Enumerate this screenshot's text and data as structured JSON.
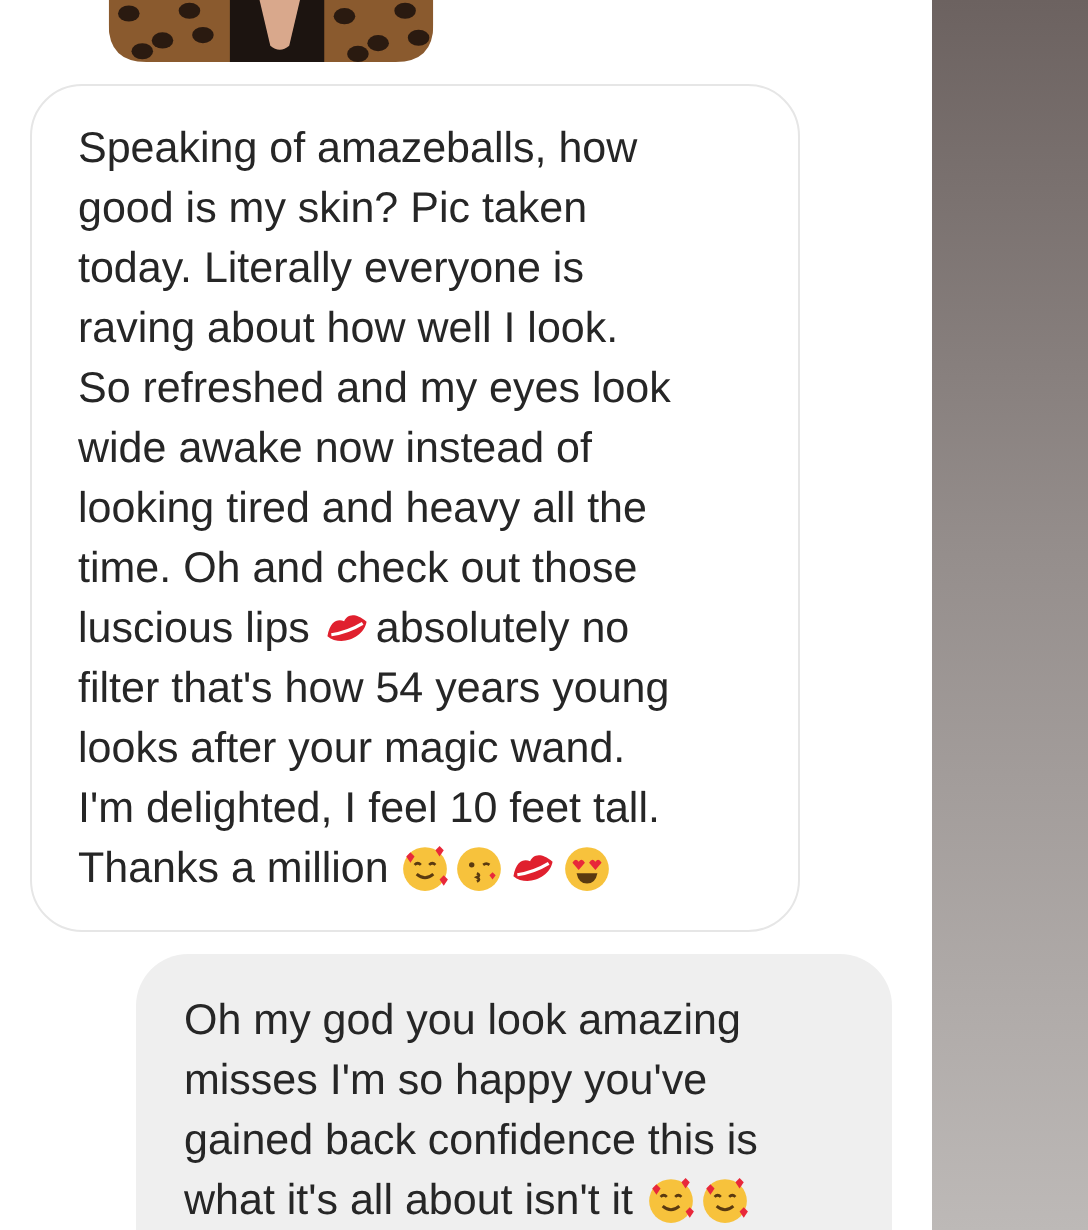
{
  "messages": [
    {
      "kind": "received",
      "lines": [
        [
          {
            "kind": "text",
            "text": "Speaking of amazeballs, how"
          }
        ],
        [
          {
            "kind": "text",
            "text": "good is my skin? Pic taken"
          }
        ],
        [
          {
            "kind": "text",
            "text": "today. Literally everyone is"
          }
        ],
        [
          {
            "kind": "text",
            "text": "raving about how well I look."
          }
        ],
        [
          {
            "kind": "text",
            "text": "So refreshed and my eyes look"
          }
        ],
        [
          {
            "kind": "text",
            "text": "wide awake now instead of"
          }
        ],
        [
          {
            "kind": "text",
            "text": "looking tired and heavy all the"
          }
        ],
        [
          {
            "kind": "text",
            "text": "time. Oh and check out those"
          }
        ],
        [
          {
            "kind": "text",
            "text": "luscious lips"
          },
          {
            "kind": "lips"
          },
          {
            "kind": "text",
            "text": "absolutely no"
          }
        ],
        [
          {
            "kind": "text",
            "text": "filter that's how 54 years young"
          }
        ],
        [
          {
            "kind": "text",
            "text": "looks after your magic wand."
          }
        ],
        [
          {
            "kind": "text",
            "text": "I'm delighted, I feel 10 feet tall."
          }
        ],
        [
          {
            "kind": "text",
            "text": "Thanks a million"
          },
          {
            "kind": "hearts_face"
          },
          {
            "kind": "kiss_face"
          },
          {
            "kind": "lips"
          },
          {
            "kind": "heart_eyes"
          }
        ]
      ]
    },
    {
      "kind": "sent",
      "lines": [
        [
          {
            "kind": "text",
            "text": "Oh my god you look amazing"
          }
        ],
        [
          {
            "kind": "text",
            "text": "misses I'm so happy you've"
          }
        ],
        [
          {
            "kind": "text",
            "text": "gained back confidence this is"
          }
        ],
        [
          {
            "kind": "text",
            "text": "what it's all about isn't it"
          },
          {
            "kind": "hearts_face"
          },
          {
            "kind": "hearts_face"
          }
        ]
      ]
    }
  ]
}
